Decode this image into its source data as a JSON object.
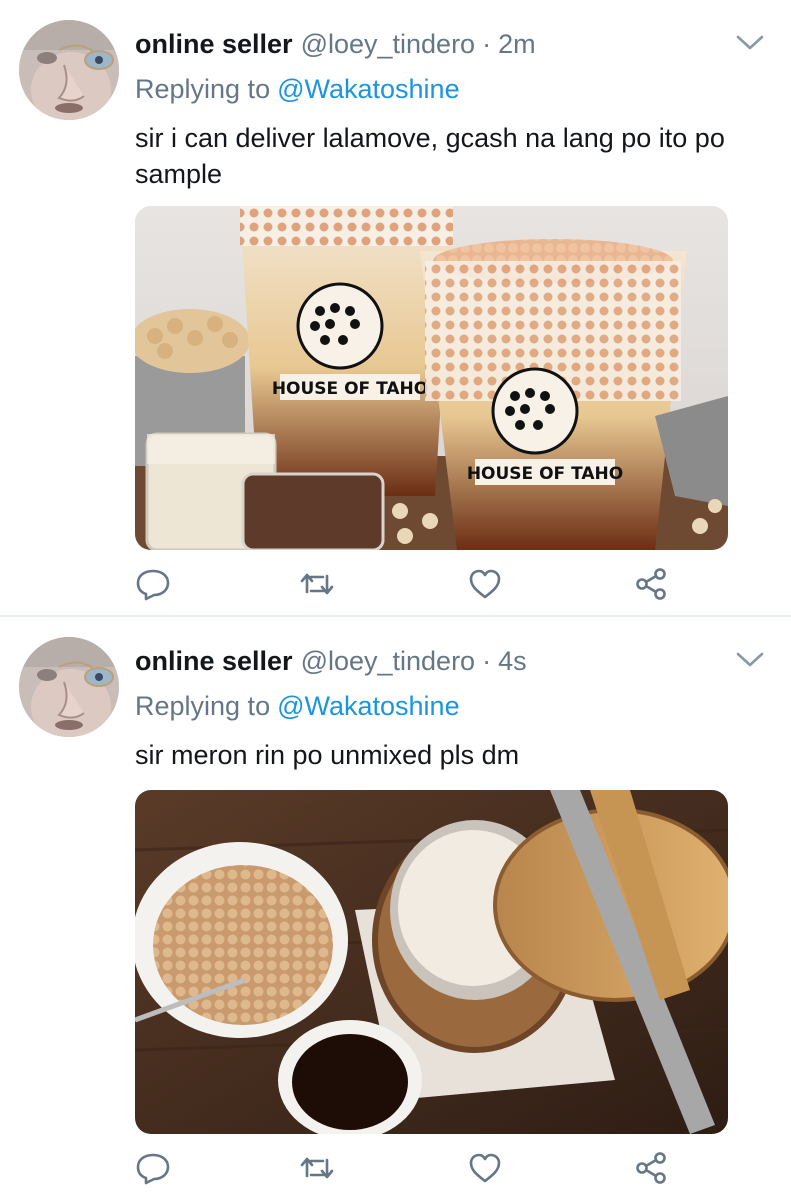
{
  "tweets": [
    {
      "display_name": "online seller",
      "handle": "@loey_tindero",
      "separator": "·",
      "time": "2m",
      "replying_label": "Replying to",
      "replying_to": "@Wakatoshine",
      "text": "sir i can deliver lalamove, gcash na lang po ito po sample",
      "media": {
        "brand_text_1": "HOUSE OF TAHO",
        "brand_text_2": "HOUSE OF TAHO"
      }
    },
    {
      "display_name": "online seller",
      "handle": "@loey_tindero",
      "separator": "·",
      "time": "4s",
      "replying_label": "Replying to",
      "replying_to": "@Wakatoshine",
      "text": "sir meron rin po unmixed pls dm"
    }
  ],
  "icons": [
    "reply-icon",
    "retweet-icon",
    "like-icon",
    "share-icon",
    "chevron-down-icon"
  ],
  "colors": {
    "text": "#14171a",
    "secondary": "#657786",
    "link": "#1b95e0",
    "divider": "#e6ecf0"
  }
}
